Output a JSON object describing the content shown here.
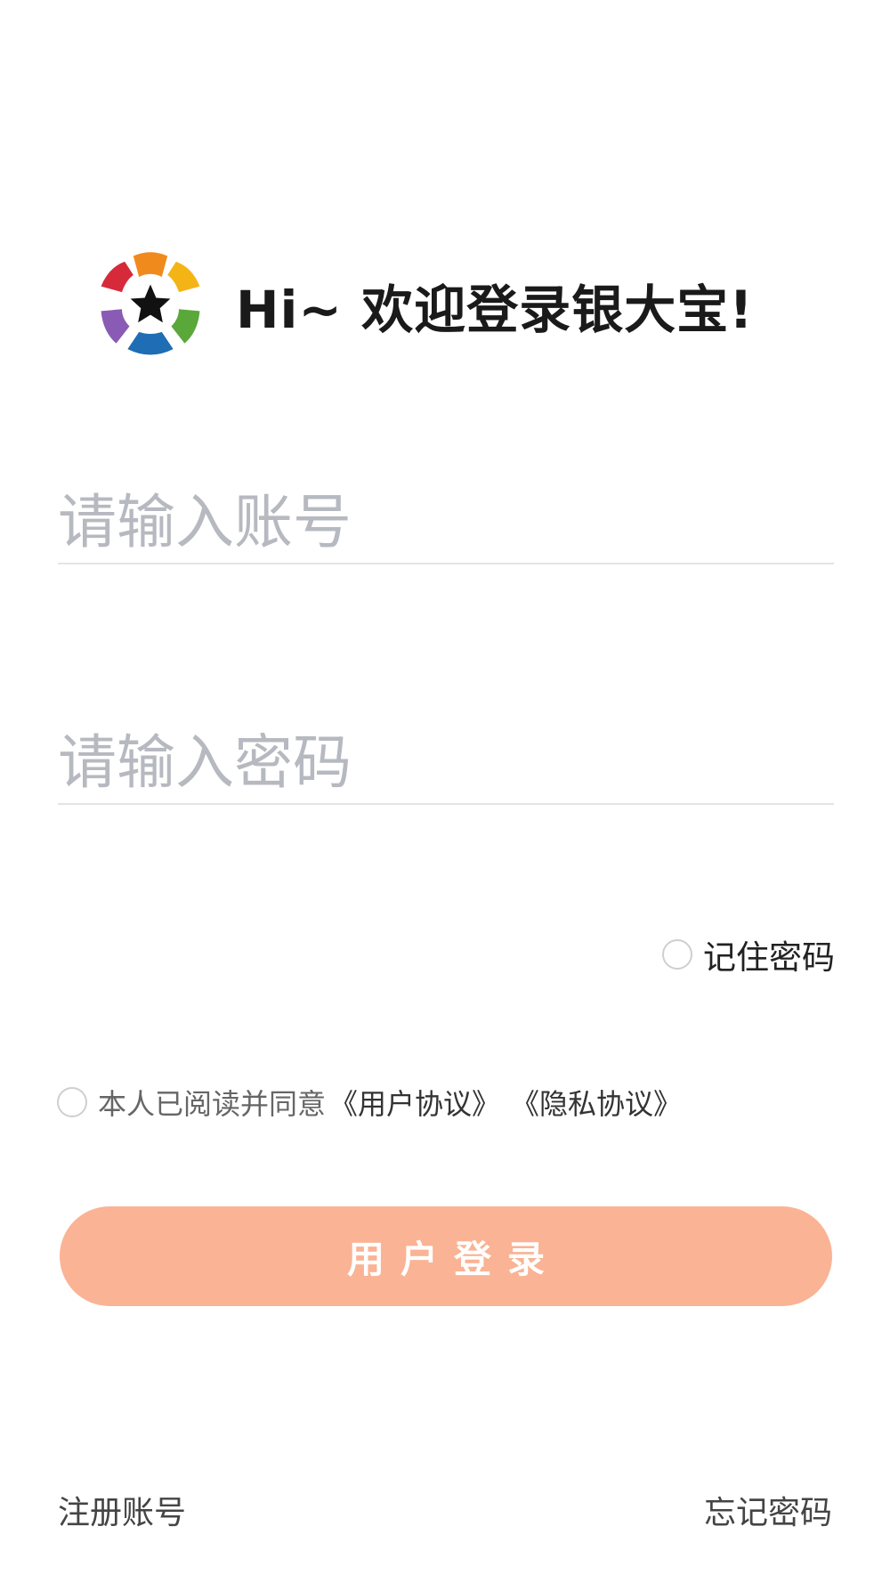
{
  "header": {
    "logo_icon": "colorful-star-flower-logo",
    "welcome_text": "Hi~ 欢迎登录银大宝!"
  },
  "form": {
    "account_placeholder": "请输入账号",
    "account_value": "",
    "password_placeholder": "请输入密码",
    "password_value": "",
    "remember_label": "记住密码",
    "remember_checked": false
  },
  "agreement": {
    "checked": false,
    "prefix": "本人已阅读并同意",
    "user_agreement": "《用户协议》",
    "privacy_policy": "《隐私协议》"
  },
  "actions": {
    "login_label": "用户登录",
    "register_label": "注册账号",
    "forgot_label": "忘记密码"
  },
  "colors": {
    "login_button": "#fab394",
    "placeholder": "#b6b9c0",
    "divider": "#e4e4e4"
  }
}
